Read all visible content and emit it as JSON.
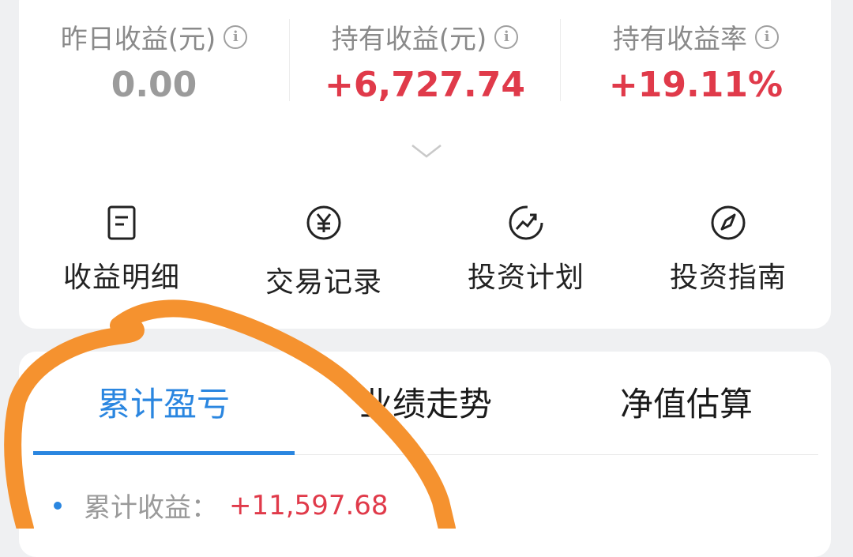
{
  "summary": {
    "stats": [
      {
        "label": "昨日收益(元)",
        "value": "0.00",
        "color": "#9b9b9b"
      },
      {
        "label": "持有收益(元)",
        "value": "+6,727.74",
        "color": "#e03a4a"
      },
      {
        "label": "持有收益率",
        "value": "+19.11%",
        "color": "#e03a4a"
      }
    ],
    "info_icon_glyph": "i",
    "expand_icon": "chevron-down-icon"
  },
  "actions": [
    {
      "label": "收益明细",
      "icon": "document-icon"
    },
    {
      "label": "交易记录",
      "icon": "yen-circle-icon"
    },
    {
      "label": "投资计划",
      "icon": "trend-circle-icon"
    },
    {
      "label": "投资指南",
      "icon": "compass-icon"
    }
  ],
  "tabs": [
    {
      "label": "累计盈亏",
      "active": true
    },
    {
      "label": "业绩走势",
      "active": false
    },
    {
      "label": "净值估算",
      "active": false
    }
  ],
  "cumulative": {
    "label": "累计收益：",
    "value": "+11,597.68"
  },
  "colors": {
    "accent": "#2a86e0",
    "gain": "#e03a4a",
    "neutral": "#9b9b9b",
    "annotation": "#f5922f"
  }
}
